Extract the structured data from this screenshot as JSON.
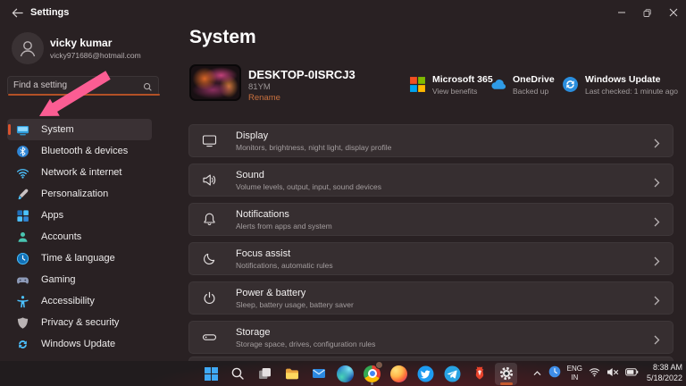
{
  "colors": {
    "accent": "#d9532e",
    "link": "#c9713f",
    "icon_blue": "#4cc2ff",
    "card_bg": "#362e30",
    "window_bg": "#292123",
    "pink_arrow": "#fb5d93"
  },
  "titlebar": {
    "title": "Settings"
  },
  "user": {
    "name": "vicky kumar",
    "email": "vicky971686@hotmail.com"
  },
  "search": {
    "placeholder": "Find a setting"
  },
  "sidebar": {
    "items": [
      {
        "label": "System",
        "icon": "system-monitor-icon",
        "selected": true
      },
      {
        "label": "Bluetooth & devices",
        "icon": "bluetooth-icon",
        "selected": false
      },
      {
        "label": "Network & internet",
        "icon": "wifi-icon",
        "selected": false
      },
      {
        "label": "Personalization",
        "icon": "brush-icon",
        "selected": false
      },
      {
        "label": "Apps",
        "icon": "apps-grid-icon",
        "selected": false
      },
      {
        "label": "Accounts",
        "icon": "person-icon",
        "selected": false
      },
      {
        "label": "Time & language",
        "icon": "clock-icon",
        "selected": false
      },
      {
        "label": "Gaming",
        "icon": "gamepad-icon",
        "selected": false
      },
      {
        "label": "Accessibility",
        "icon": "accessibility-icon",
        "selected": false
      },
      {
        "label": "Privacy & security",
        "icon": "shield-icon",
        "selected": false
      },
      {
        "label": "Windows Update",
        "icon": "update-arrows-icon",
        "selected": false
      }
    ]
  },
  "main": {
    "title": "System",
    "device": {
      "name": "DESKTOP-0ISRCJ3",
      "model": "81YM",
      "rename_label": "Rename"
    },
    "status_items": [
      {
        "title": "Microsoft 365",
        "subtitle": "View benefits",
        "icon": "microsoft-365-icon"
      },
      {
        "title": "OneDrive",
        "subtitle": "Backed up",
        "icon": "onedrive-cloud-icon"
      },
      {
        "title": "Windows Update",
        "subtitle": "Last checked: 1 minute ago",
        "icon": "windows-update-icon"
      }
    ],
    "settings": [
      {
        "title": "Display",
        "subtitle": "Monitors, brightness, night light, display profile",
        "icon": "display-icon"
      },
      {
        "title": "Sound",
        "subtitle": "Volume levels, output, input, sound devices",
        "icon": "speaker-icon"
      },
      {
        "title": "Notifications",
        "subtitle": "Alerts from apps and system",
        "icon": "bell-icon"
      },
      {
        "title": "Focus assist",
        "subtitle": "Notifications, automatic rules",
        "icon": "moon-icon"
      },
      {
        "title": "Power & battery",
        "subtitle": "Sleep, battery usage, battery saver",
        "icon": "power-icon"
      },
      {
        "title": "Storage",
        "subtitle": "Storage space, drives, configuration rules",
        "icon": "storage-drive-icon"
      }
    ]
  },
  "annotation": {
    "type": "pink-arrow",
    "points_at": "System sidebar item"
  },
  "taskbar": {
    "apps": [
      "start",
      "search",
      "task-view",
      "file-explorer",
      "mail",
      "edge",
      "chrome",
      "firefox",
      "twitter",
      "telegram",
      "brave",
      "settings"
    ],
    "active_app": "settings",
    "running_app": "chrome",
    "tray": {
      "language_top": "ENG",
      "language_bottom": "IN",
      "time": "8:38 AM",
      "date": "5/18/2022"
    }
  }
}
